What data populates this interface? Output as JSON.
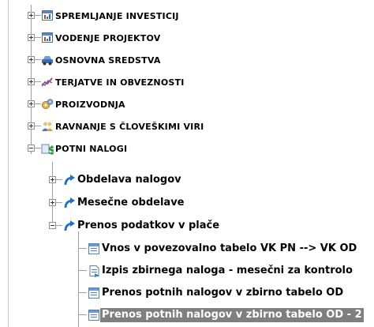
{
  "tree": {
    "top_nodes": [
      {
        "label": "SPREMLJANJE INVESTICIJ",
        "icon": "chart-window-icon"
      },
      {
        "label": "VODENJE PROJEKTOV",
        "icon": "chart-window-icon"
      },
      {
        "label": "OSNOVNA SREDSTVA",
        "icon": "car-icon"
      },
      {
        "label": "TERJATVE IN OBVEZNOSTI",
        "icon": "trend-line-icon"
      },
      {
        "label": "PROIZVODNJA",
        "icon": "gears-icon"
      },
      {
        "label": "RAVNANJE S ČLOVEŠKIMI VIRI",
        "icon": "people-icon"
      },
      {
        "label": "POTNI NALOGI",
        "icon": "travel-money-icon"
      }
    ],
    "potni_children": [
      {
        "label": "Obdelava nalogov",
        "icon": "blue-arrow-icon"
      },
      {
        "label": "Mesečne obdelave",
        "icon": "blue-arrow-icon"
      },
      {
        "label": "Prenos podatkov v plače",
        "icon": "blue-arrow-icon"
      }
    ],
    "prenos_children": [
      {
        "label": "Vnos v povezovalno tabelo VK PN --> VK OD",
        "icon": "form-window-icon"
      },
      {
        "label": "Izpis zbirnega naloga - mesečni za kontrolo",
        "icon": "report-doc-icon"
      },
      {
        "label": "Prenos potnih nalogov v zbirno tabelo OD",
        "icon": "form-window-icon"
      },
      {
        "label": "Prenos potnih nalogov v zbirno tabelo OD - 2",
        "icon": "form-window-icon",
        "selected": true
      }
    ]
  }
}
